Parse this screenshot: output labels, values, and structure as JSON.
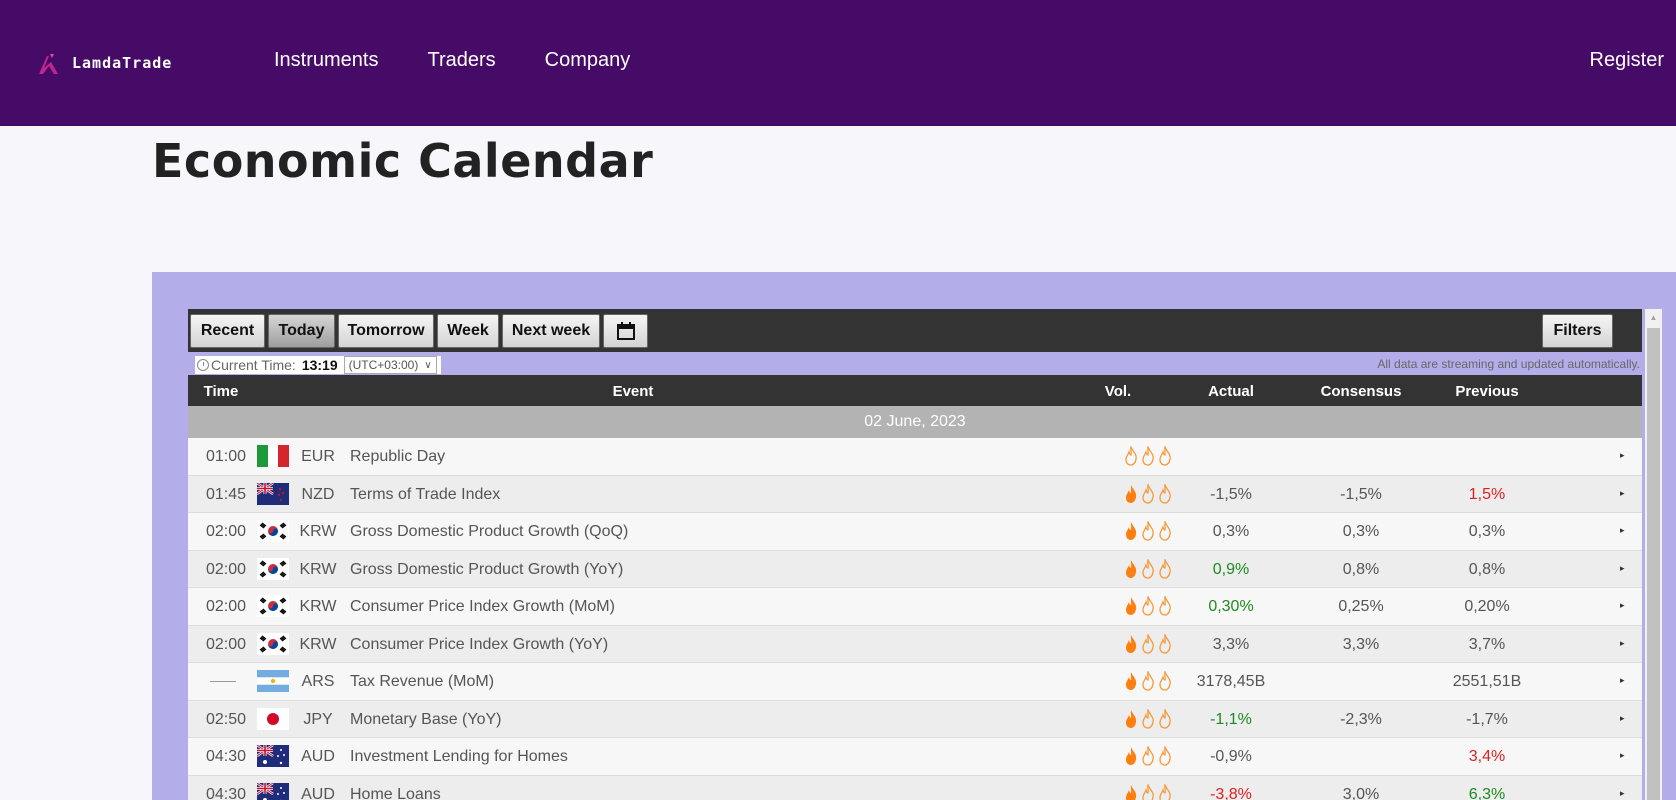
{
  "header": {
    "logo_text": "LamdaTrade",
    "nav": [
      "Instruments",
      "Traders",
      "Company"
    ],
    "register_label": "Register",
    "bg_color": "#460b66"
  },
  "page_title": "Economic Calendar",
  "calendar": {
    "toolbar": {
      "buttons": [
        "Recent",
        "Today",
        "Tomorrow",
        "Week",
        "Next week"
      ],
      "active": "Today",
      "calendar_icon": "calendar-icon",
      "filters_label": "Filters"
    },
    "current_time_label": "Current Time:",
    "current_time": "13:19",
    "timezone": "(UTC+03:00)",
    "streaming_note": "All data are streaming and updated automatically.",
    "columns": {
      "time": "Time",
      "event": "Event",
      "vol": "Vol.",
      "actual": "Actual",
      "consensus": "Consensus",
      "previous": "Previous"
    },
    "date": "02 June, 2023",
    "rows": [
      {
        "time": "01:00",
        "flag": "italy",
        "currency": "EUR",
        "event": "Republic Day",
        "vol": 0,
        "actual": "",
        "actual_dir": "",
        "consensus": "",
        "previous": "",
        "previous_dir": ""
      },
      {
        "time": "01:45",
        "flag": "new-zealand",
        "currency": "NZD",
        "event": "Terms of Trade Index",
        "vol": 1,
        "actual": "-1,5%",
        "actual_dir": "",
        "consensus": "-1,5%",
        "previous": "1,5%",
        "previous_dir": "down"
      },
      {
        "time": "02:00",
        "flag": "south-korea",
        "currency": "KRW",
        "event": "Gross Domestic Product Growth (QoQ)",
        "vol": 1,
        "actual": "0,3%",
        "actual_dir": "",
        "consensus": "0,3%",
        "previous": "0,3%",
        "previous_dir": ""
      },
      {
        "time": "02:00",
        "flag": "south-korea",
        "currency": "KRW",
        "event": "Gross Domestic Product Growth (YoY)",
        "vol": 1,
        "actual": "0,9%",
        "actual_dir": "up",
        "consensus": "0,8%",
        "previous": "0,8%",
        "previous_dir": ""
      },
      {
        "time": "02:00",
        "flag": "south-korea",
        "currency": "KRW",
        "event": "Consumer Price Index Growth (MoM)",
        "vol": 1,
        "actual": "0,30%",
        "actual_dir": "up",
        "consensus": "0,25%",
        "previous": "0,20%",
        "previous_dir": ""
      },
      {
        "time": "02:00",
        "flag": "south-korea",
        "currency": "KRW",
        "event": "Consumer Price Index Growth (YoY)",
        "vol": 1,
        "actual": "3,3%",
        "actual_dir": "",
        "consensus": "3,3%",
        "previous": "3,7%",
        "previous_dir": ""
      },
      {
        "time": "",
        "flag": "argentina",
        "currency": "ARS",
        "event": "Tax Revenue (MoM)",
        "vol": 1,
        "actual": "3178,45B",
        "actual_dir": "",
        "consensus": "",
        "previous": "2551,51B",
        "previous_dir": ""
      },
      {
        "time": "02:50",
        "flag": "japan",
        "currency": "JPY",
        "event": "Monetary Base (YoY)",
        "vol": 1,
        "actual": "-1,1%",
        "actual_dir": "up",
        "consensus": "-2,3%",
        "previous": "-1,7%",
        "previous_dir": ""
      },
      {
        "time": "04:30",
        "flag": "australia",
        "currency": "AUD",
        "event": "Investment Lending for Homes",
        "vol": 1,
        "actual": "-0,9%",
        "actual_dir": "",
        "consensus": "",
        "previous": "3,4%",
        "previous_dir": "down"
      },
      {
        "time": "04:30",
        "flag": "australia",
        "currency": "AUD",
        "event": "Home Loans",
        "vol": 1,
        "actual": "-3,8%",
        "actual_dir": "down",
        "consensus": "3,0%",
        "previous": "6,3%",
        "previous_dir": "up"
      }
    ]
  }
}
